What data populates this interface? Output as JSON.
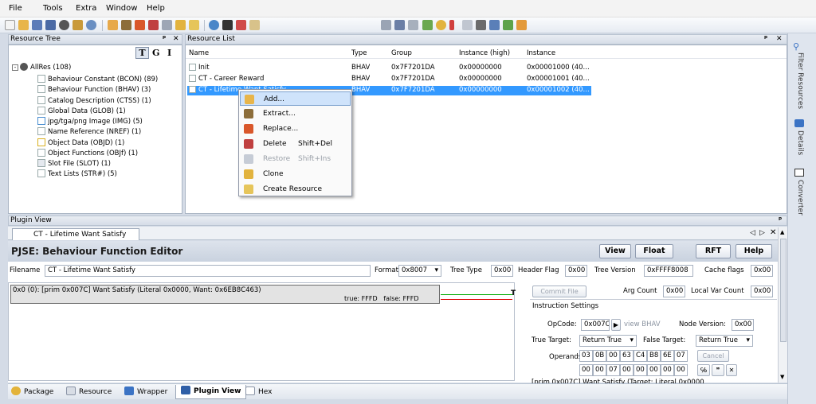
{
  "menu": [
    "File",
    "Tools",
    "Extra",
    "Window",
    "Help"
  ],
  "resource_tree": {
    "title": "Resource Tree",
    "filter_buttons": [
      "T",
      "G",
      "I"
    ],
    "root": "AllRes (108)",
    "items": [
      "Behaviour Constant (BCON) (89)",
      "Behaviour Function (BHAV) (3)",
      "Catalog Description (CTSS) (1)",
      "Global Data (GLOB) (1)",
      "jpg/tga/png Image (IMG) (5)",
      "Name Reference (NREF) (1)",
      "Object Data (OBJD) (1)",
      "Object Functions (OBJf) (1)",
      "Slot File (SLOT) (1)",
      "Text Lists (STR#) (5)"
    ]
  },
  "resource_list": {
    "title": "Resource List",
    "columns": [
      "Name",
      "Type",
      "Group",
      "Instance (high)",
      "Instance"
    ],
    "rows": [
      [
        "Init",
        "BHAV",
        "0x7F7201DA",
        "0x00000000",
        "0x00001000 (40..."
      ],
      [
        "CT - Career Reward",
        "BHAV",
        "0x7F7201DA",
        "0x00000000",
        "0x00001001 (40..."
      ],
      [
        "CT - Lifetime Want Satisfy",
        "BHAV",
        "0x7F7201DA",
        "0x00000000",
        "0x00001002 (40..."
      ]
    ]
  },
  "context_menu": [
    {
      "label": "Add...",
      "shortcut": "",
      "icon": "add-icon",
      "enabled": true,
      "highlight": true
    },
    {
      "label": "Extract...",
      "shortcut": "",
      "icon": "extract-icon",
      "enabled": true
    },
    {
      "label": "Replace...",
      "shortcut": "",
      "icon": "replace-icon",
      "enabled": true
    },
    {
      "label": "Delete",
      "shortcut": "Shift+Del",
      "icon": "delete-icon",
      "enabled": true
    },
    {
      "label": "Restore",
      "shortcut": "Shift+Ins",
      "icon": "restore-icon",
      "enabled": false
    },
    {
      "label": "Clone",
      "shortcut": "",
      "icon": "clone-icon",
      "enabled": true
    },
    {
      "label": "Create Resource",
      "shortcut": "",
      "icon": "create-resource-icon",
      "enabled": true
    }
  ],
  "plugin_view": {
    "title": "Plugin View",
    "tab": "CT - Lifetime Want Satisfy",
    "editor_title": "PJSE: Behaviour Function Editor",
    "buttons": [
      "View",
      "Float",
      "RFT",
      "Help"
    ],
    "filename_label": "Filename",
    "filename": "CT - Lifetime Want Satisfy",
    "format_label": "Format",
    "format": "0x8007",
    "tree_type_label": "Tree Type",
    "tree_type": "0x00",
    "header_flag_label": "Header Flag",
    "header_flag": "0x00",
    "tree_version_label": "Tree Version",
    "tree_version": "0xFFFF8008",
    "cache_flags_label": "Cache flags",
    "cache_flags": "0x00",
    "instruction": "0x0 (0): [prim 0x007C] Want Satisfy (Literal 0x0000, Want: 0x6EB8C463)",
    "true_false": "true: FFFD   false: FFFD",
    "commit_file": "Commit File",
    "arg_count_label": "Arg Count",
    "arg_count": "0x00",
    "local_var_label": "Local Var Count",
    "local_var": "0x00",
    "instruction_settings": "Instruction Settings",
    "opcode_label": "OpCode:",
    "opcode": "0x007C",
    "view_bhav": "view BHAV",
    "node_version_label": "Node Version:",
    "node_version": "0x00",
    "true_target_label": "True Target:",
    "true_target": "Return True",
    "false_target_label": "False Target:",
    "false_target": "Return True",
    "operands_label": "Operands:",
    "operands_row1": [
      "03",
      "0B",
      "00",
      "63",
      "C4",
      "B8",
      "6E",
      "07"
    ],
    "operands_row2": [
      "00",
      "00",
      "07",
      "00",
      "00",
      "00",
      "00",
      "00"
    ],
    "cancel": "Cancel",
    "description": "[prim 0x007C] Want Satisfy (Target: Literal 0x0000"
  },
  "bottom_tabs": [
    "Package",
    "Resource",
    "Wrapper",
    "Plugin View",
    "Hex"
  ],
  "right_bar": [
    "Filter Resources",
    "Details",
    "Converter"
  ],
  "colors": {
    "accent": "#3399ff",
    "selection": "#3399ff",
    "menu_highlight": "#cfe3fb"
  }
}
